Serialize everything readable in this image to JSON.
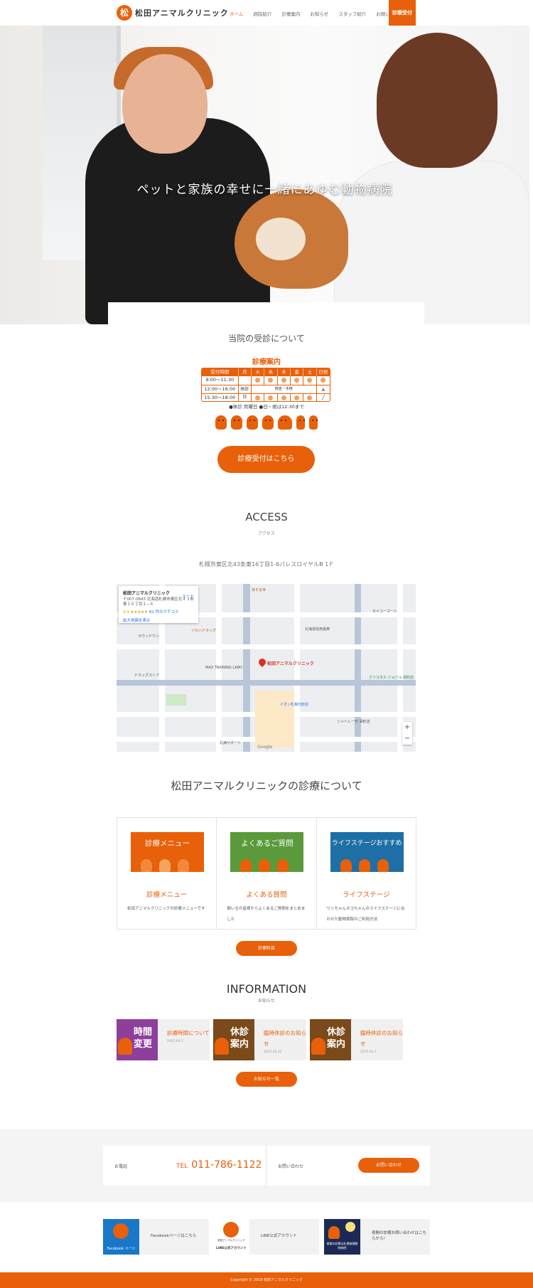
{
  "colors": {
    "accent": "#e8600a",
    "green": "#5a9a3a",
    "blue": "#1e6fa6",
    "purple": "#8e3f9c",
    "brown": "#7a4a1a"
  },
  "header": {
    "logo_mark": "松",
    "logo_text": "松田アニマルクリニック",
    "nav": [
      "ホーム",
      "病院紹介",
      "診療案内",
      "お知らせ",
      "スタッフ紹介",
      "お問い合わせ"
    ],
    "cta": "診療受付"
  },
  "hero": {
    "tagline": "ペットと家族の幸せに一緒にあゆむ動物病院"
  },
  "consult": {
    "title": "当院の受診について",
    "schedule_title": "診療案内",
    "head": [
      "受付時間",
      "月",
      "火",
      "水",
      "木",
      "金",
      "土",
      "日祝"
    ],
    "rows": [
      "9:00～11:30",
      "12:00～16:00",
      "15:30～18:00"
    ],
    "closed_label": "休診日",
    "surgery_label": "検査・手術",
    "note_closed": "●休診 月曜日",
    "note_sun": "●日・祝は12:30まで",
    "button": "診療受付はこちら"
  },
  "access": {
    "title": "ACCESS",
    "subtitle": "アクセス",
    "address": "札幌市東区北43条東16丁目1-6パレスロイヤルⅢ 1Ｆ",
    "map": {
      "card_name": "松田アニマルクリニック",
      "card_address": "〒007-0843 北海道札幌市東区北４３条東１６丁目１−６",
      "card_rating": "4.4 ★★★★★",
      "card_reviews": "82 件のクチコミ",
      "card_route": "ルート",
      "card_larger": "拡大地図を表示",
      "pin_label": "松田アニマルクリニック",
      "zoom_in": "+",
      "zoom_out": "−",
      "labels": [
        "あすま寺",
        "ラウンドワン",
        "北海道信用金庫",
        "セイコーマート",
        "ドラッグストア",
        "MAX TRAINING LABO",
        "イオン札幌元町店",
        "クリスタル ジョジョ 栄町店",
        "シャトレーゼ 栄町店",
        "ツルハドラッグ",
        "北海サポート",
        "Google"
      ]
    }
  },
  "about": {
    "title": "松田アニマルクリニックの診療について",
    "cards": [
      {
        "img_label": "診療メニュー",
        "title": "診療メニュー",
        "desc": "松田アニマルクリニックの診療メニューです"
      },
      {
        "img_label": "よくあるご質問",
        "title": "よくある質問",
        "desc": "飼い主の皆様からよくあるご質問をまとめました"
      },
      {
        "img_label": "ライフステージおすすめ",
        "title": "ライフステージ",
        "desc": "ワンちゃんネコちゃんのライフステージに合わせた動物病院のご利用方法"
      }
    ],
    "button": "診療科目"
  },
  "information": {
    "title": "INFORMATION",
    "subtitle": "お知らせ",
    "items": [
      {
        "img_label": "時間変更",
        "title": "診療時間について",
        "date": "2025.04.5"
      },
      {
        "img_label": "休診案内",
        "title": "臨時休診のお知らせ",
        "date": "2025.02.22"
      },
      {
        "img_label": "休診案内",
        "title": "臨時休診のお知らせ",
        "date": "2025.02.1"
      }
    ],
    "button": "お知らせ一覧"
  },
  "contact": {
    "phone_label": "お電話",
    "tel_prefix": "TEL",
    "tel_number": "011-786-1122",
    "inquiry_label": "お問い合わせ",
    "button": "お問い合わせ"
  },
  "social": [
    {
      "img_label": "Facebook ページ",
      "text": "Facebookページはこちら"
    },
    {
      "img_label": "LINE公式アカウント",
      "img_sub": "松田アニマルクリニック",
      "text": "LINE公式アカウント"
    },
    {
      "img_label": "夜間の診療は札幌夜間動物病院",
      "text": "夜間の診療お問い合わせはこちらから！"
    }
  ],
  "footer": {
    "copyright": "Copyright © 2019 松田アニマルクリニック"
  }
}
